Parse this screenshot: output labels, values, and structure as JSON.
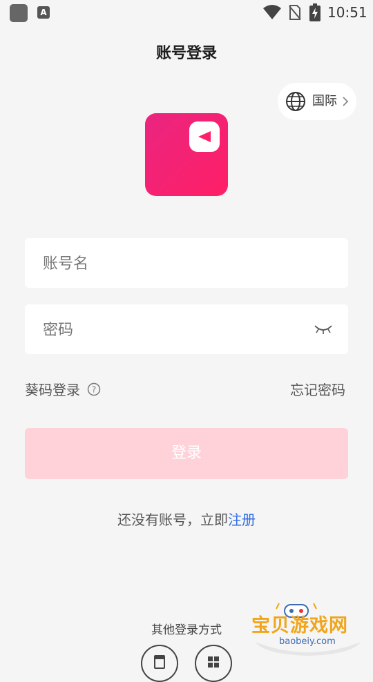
{
  "status_bar": {
    "time": "10:51",
    "app_icon_2_letter": "A",
    "icons": [
      "app-notification-icon",
      "font-app-icon",
      "wifi-icon",
      "no-sim-icon",
      "battery-charging-icon"
    ]
  },
  "header": {
    "title": "账号登录"
  },
  "region": {
    "label": "国际",
    "icon": "globe-icon"
  },
  "form": {
    "username_placeholder": "账号名",
    "password_placeholder": "密码",
    "username_value": "",
    "password_value": ""
  },
  "aux": {
    "code_login": "葵码登录",
    "forgot_password": "忘记密码"
  },
  "login_button": "登录",
  "signup": {
    "prefix": "还没有账号，立即",
    "link": "注册"
  },
  "other_login": {
    "label": "其他登录方式"
  },
  "watermark": {
    "title": "宝贝游戏网",
    "url": "baobeiy.com"
  },
  "colors": {
    "accent": "#ff1f66",
    "button_disabled": "#ffd2d9",
    "link": "#2f6ce1",
    "background": "#f5f5f5"
  }
}
